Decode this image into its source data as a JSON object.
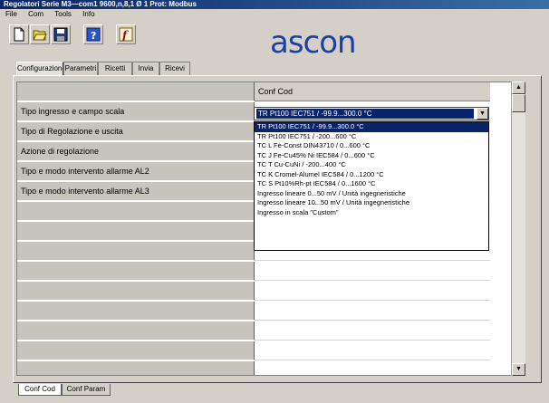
{
  "window": {
    "title": "Regolatori Serie M3—com1 9600,n,8,1 Ø 1 Prot: Modbus"
  },
  "menu": {
    "items": [
      "File",
      "Com",
      "Tools",
      "Info"
    ]
  },
  "toolbar": {
    "icons": [
      "new-document-icon",
      "open-folder-icon",
      "save-disk-icon",
      "help-icon",
      "function-icon"
    ]
  },
  "logo": {
    "text": "ascon",
    "color": "#1c3fa8"
  },
  "tabs": [
    {
      "label": "Configurazione",
      "active": true
    },
    {
      "label": "Parametri",
      "active": false
    },
    {
      "label": "Ricetti",
      "active": false
    },
    {
      "label": "Invia",
      "active": false
    },
    {
      "label": "Ricevi",
      "active": false
    }
  ],
  "grid": {
    "header_value": "Conf Cod",
    "rows": [
      {
        "label": "",
        "value": "Conf Cod"
      },
      {
        "label": "Tipo ingresso e campo scala",
        "value": ""
      },
      {
        "label": "Tipo di Regolazione e uscita",
        "value": ""
      },
      {
        "label": "Azione di regolazione",
        "value": ""
      },
      {
        "label": "Tipo e modo intervento allarme AL2",
        "value": ""
      },
      {
        "label": "Tipo e modo intervento allarme AL3",
        "value": ""
      },
      {
        "label": "",
        "value": ""
      },
      {
        "label": "",
        "value": ""
      },
      {
        "label": "",
        "value": ""
      },
      {
        "label": "",
        "value": ""
      },
      {
        "label": "",
        "value": ""
      },
      {
        "label": "",
        "value": ""
      },
      {
        "label": "",
        "value": ""
      },
      {
        "label": "",
        "value": ""
      },
      {
        "label": "",
        "value": ""
      }
    ]
  },
  "combo": {
    "selected": "TR Pt100 IEC751 / -99.9...300.0 °C",
    "options": [
      {
        "label": "TR Pt100 IEC751 / -99.9...300.0 °C",
        "selected": true
      },
      {
        "label": "TR Pt100 IEC751 / -200...600 °C",
        "selected": false
      },
      {
        "label": "TC L Fe-Const DIN43710 / 0...600 °C",
        "selected": false
      },
      {
        "label": "TC J Fe-Cu45% Ni IEC584 / 0...600 °C",
        "selected": false
      },
      {
        "label": "TC T Cu-CuNi / -200...400 °C",
        "selected": false
      },
      {
        "label": "TC K Cromel-Alumel IEC584 / 0...1200 °C",
        "selected": false
      },
      {
        "label": "TC S Pt10%Rh-pt IEC584 / 0...1600 °C",
        "selected": false
      },
      {
        "label": "Ingresso lineare 0...50 mV / Unità ingegneristiche",
        "selected": false
      },
      {
        "label": "Ingresso lineare 10...50 mV / Unità ingegneristiche",
        "selected": false
      },
      {
        "label": "Ingresso in scala \"Custom\"",
        "selected": false
      }
    ]
  },
  "sheets": [
    {
      "label": "Conf Cod",
      "active": true
    },
    {
      "label": "Conf Param",
      "active": false
    }
  ]
}
